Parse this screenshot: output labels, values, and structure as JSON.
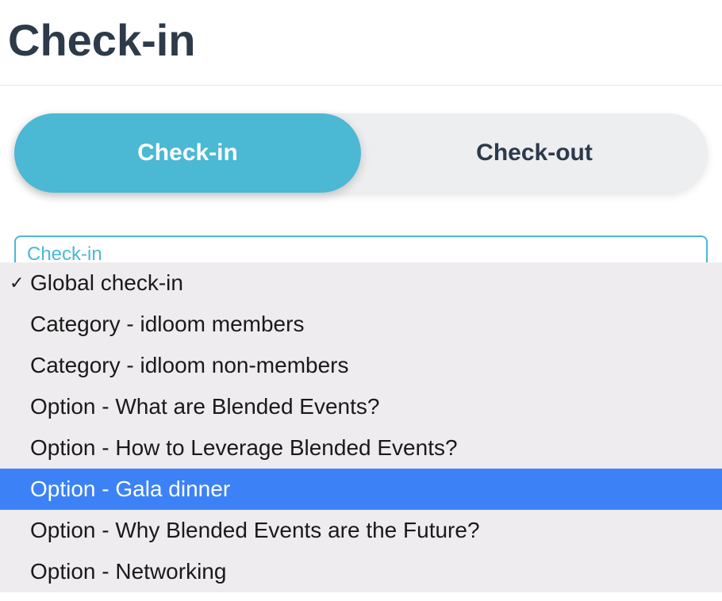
{
  "header": {
    "title": "Check-in"
  },
  "toggle": {
    "checkin_label": "Check-in",
    "checkout_label": "Check-out",
    "active": "checkin"
  },
  "select": {
    "label": "Check-in",
    "selected_index": 0,
    "highlighted_index": 5,
    "options": [
      {
        "label": "Global check-in"
      },
      {
        "label": "Category - idloom members"
      },
      {
        "label": "Category - idloom non-members"
      },
      {
        "label": "Option - What are Blended Events?"
      },
      {
        "label": "Option - How to Leverage Blended Events?"
      },
      {
        "label": "Option - Gala dinner"
      },
      {
        "label": "Option - Why Blended Events are the Future?"
      },
      {
        "label": "Option - Networking"
      }
    ]
  },
  "colors": {
    "accent": "#4bb8d4",
    "highlight": "#3c82f6",
    "text_dark": "#2d3a4a"
  }
}
